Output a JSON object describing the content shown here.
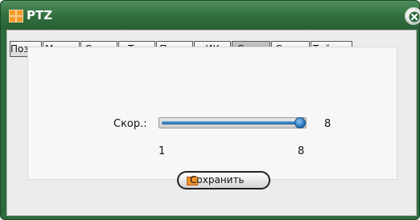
{
  "window": {
    "title": "PTZ",
    "accent_color": "#2e6a3c"
  },
  "tabs": [
    {
      "label": "Позиц",
      "active": false
    },
    {
      "label": "Марш.",
      "active": false
    },
    {
      "label": "Скан.",
      "active": false
    },
    {
      "label": "Тур",
      "active": false
    },
    {
      "label": "Пауза",
      "active": false
    },
    {
      "label": "ИК",
      "active": false
    },
    {
      "label": "Скор.",
      "active": true
    },
    {
      "label": "Север",
      "active": false
    },
    {
      "label": "Таймер",
      "active": false
    }
  ],
  "speed": {
    "label": "Скор.:",
    "value": "8",
    "min_label": "1",
    "max_label": "8",
    "level": 1.0
  },
  "save_button": {
    "label": "Сохранить"
  },
  "icons": {
    "app": "ptz-app-icon",
    "close": "close-icon",
    "save": "save-icon"
  }
}
